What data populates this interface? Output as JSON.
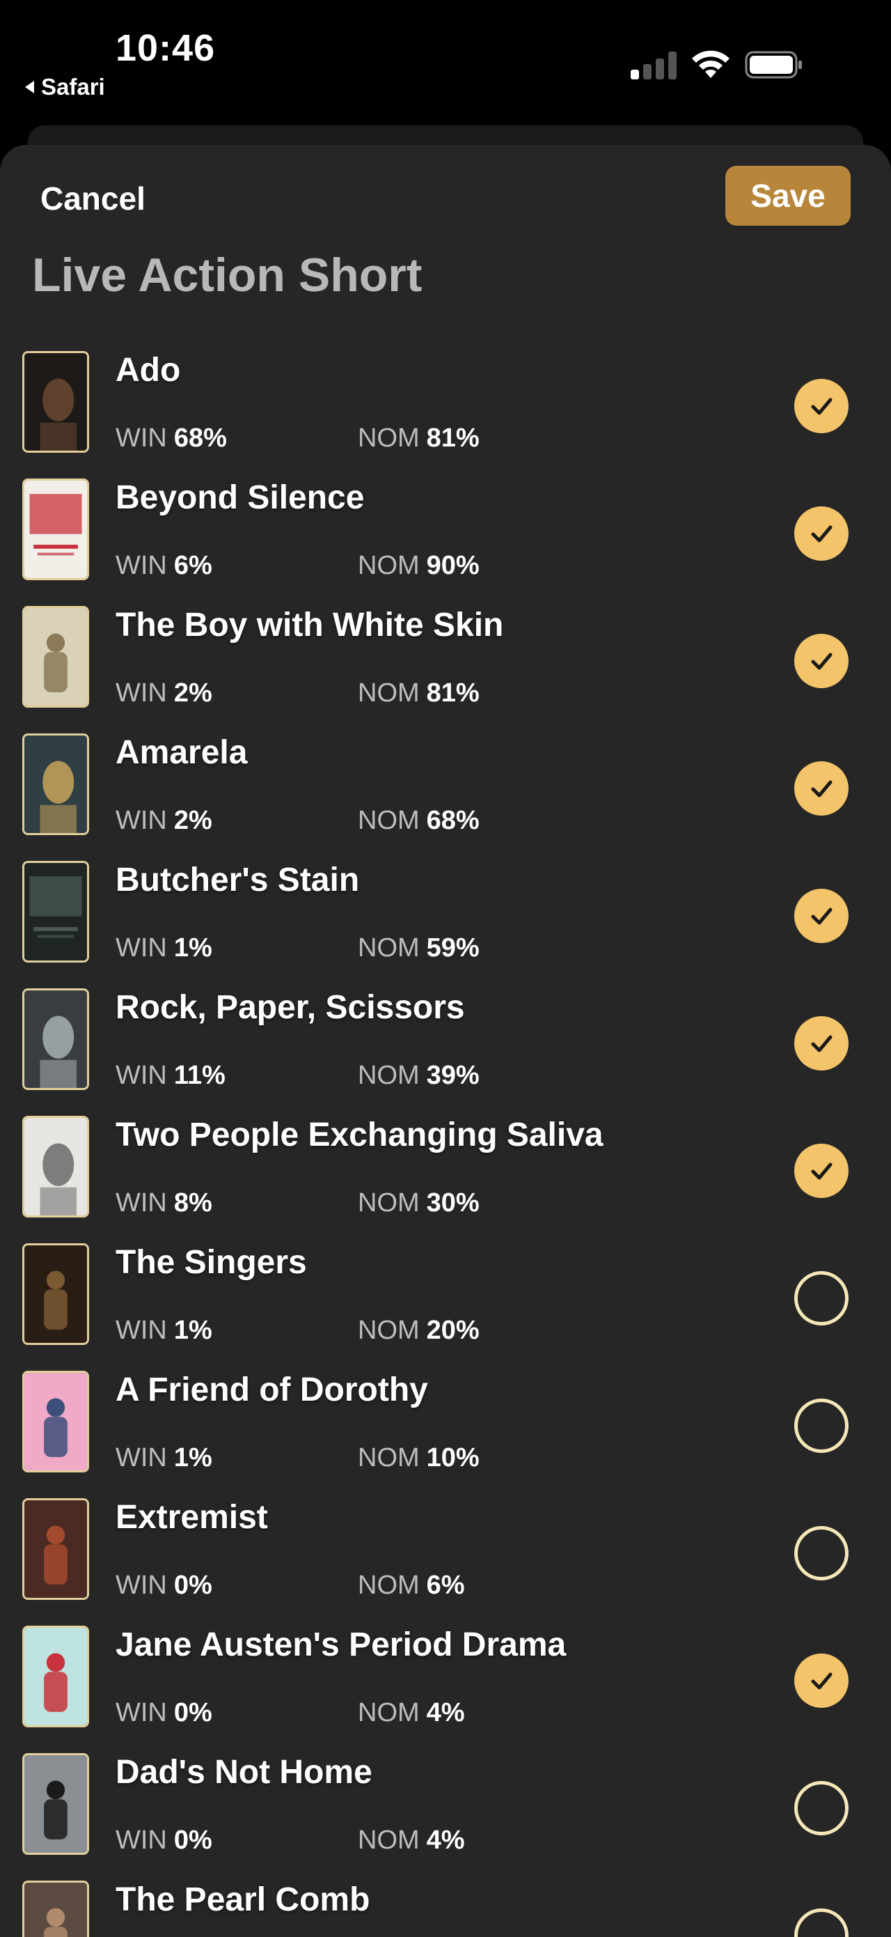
{
  "status_bar": {
    "time": "10:46",
    "back_app": "Safari"
  },
  "header": {
    "cancel_label": "Cancel",
    "save_label": "Save",
    "category_title": "Live Action Short"
  },
  "colors": {
    "accent_gold": "#b8863a",
    "check_fill": "#f4c46a",
    "sheet_bg": "#262626"
  },
  "nominees": [
    {
      "title": "Ado",
      "win_label": "WIN",
      "win": "68%",
      "nom_label": "NOM",
      "nom": "81%",
      "selected": true,
      "poster": "poster-ado"
    },
    {
      "title": "Beyond Silence",
      "win_label": "WIN",
      "win": "6%",
      "nom_label": "NOM",
      "nom": "90%",
      "selected": true,
      "poster": "poster-beyond-silence"
    },
    {
      "title": "The Boy with White Skin",
      "win_label": "WIN",
      "win": "2%",
      "nom_label": "NOM",
      "nom": "81%",
      "selected": true,
      "poster": "poster-boy-white-skin"
    },
    {
      "title": "Amarela",
      "win_label": "WIN",
      "win": "2%",
      "nom_label": "NOM",
      "nom": "68%",
      "selected": true,
      "poster": "poster-amarela"
    },
    {
      "title": "Butcher's Stain",
      "win_label": "WIN",
      "win": "1%",
      "nom_label": "NOM",
      "nom": "59%",
      "selected": true,
      "poster": "poster-butchers-stain"
    },
    {
      "title": "Rock, Paper, Scissors",
      "win_label": "WIN",
      "win": "11%",
      "nom_label": "NOM",
      "nom": "39%",
      "selected": true,
      "poster": "poster-rock-paper-scissors"
    },
    {
      "title": "Two People Exchanging Saliva",
      "win_label": "WIN",
      "win": "8%",
      "nom_label": "NOM",
      "nom": "30%",
      "selected": true,
      "poster": "poster-two-people"
    },
    {
      "title": "The Singers",
      "win_label": "WIN",
      "win": "1%",
      "nom_label": "NOM",
      "nom": "20%",
      "selected": false,
      "poster": "poster-singers"
    },
    {
      "title": "A Friend of Dorothy",
      "win_label": "WIN",
      "win": "1%",
      "nom_label": "NOM",
      "nom": "10%",
      "selected": false,
      "poster": "poster-friend-dorothy"
    },
    {
      "title": "Extremist",
      "win_label": "WIN",
      "win": "0%",
      "nom_label": "NOM",
      "nom": "6%",
      "selected": false,
      "poster": "poster-extremist"
    },
    {
      "title": "Jane Austen's Period Drama",
      "win_label": "WIN",
      "win": "0%",
      "nom_label": "NOM",
      "nom": "4%",
      "selected": true,
      "poster": "poster-jane-austen"
    },
    {
      "title": "Dad's Not Home",
      "win_label": "WIN",
      "win": "0%",
      "nom_label": "NOM",
      "nom": "4%",
      "selected": false,
      "poster": "poster-dads-not-home"
    },
    {
      "title": "The Pearl Comb",
      "win_label": "",
      "win": "",
      "nom_label": "",
      "nom": "",
      "selected": false,
      "poster": "poster-pearl-comb"
    }
  ]
}
